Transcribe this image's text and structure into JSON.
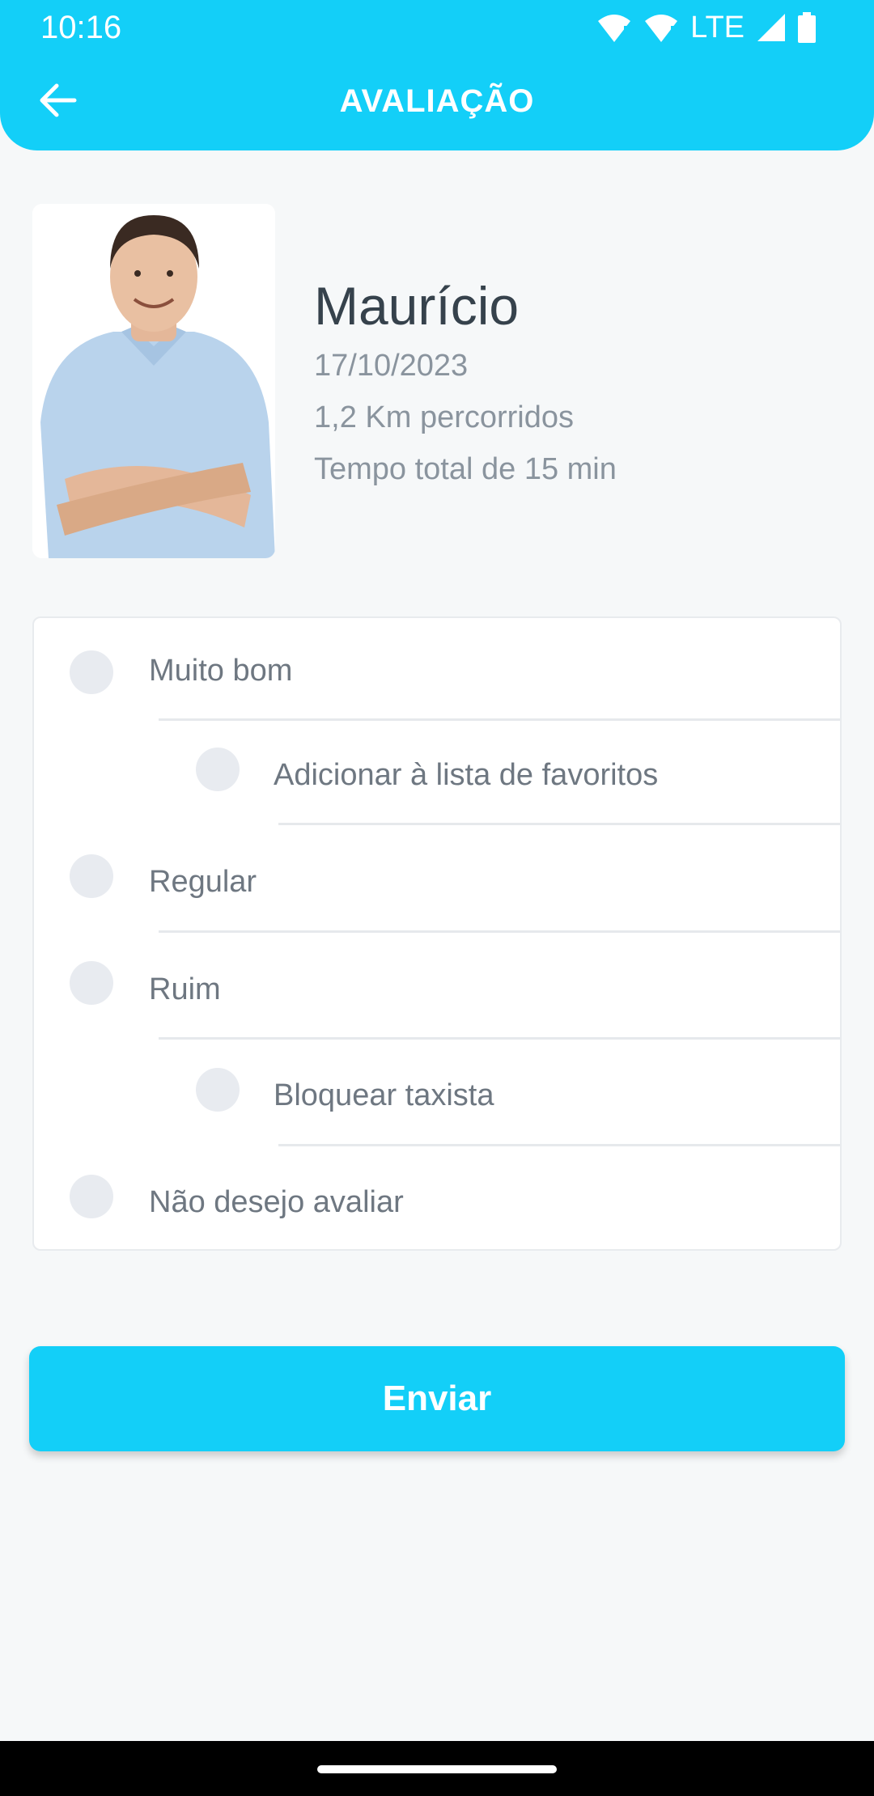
{
  "status_bar": {
    "time": "10:16",
    "network": "LTE",
    "icons": [
      "wifi-alert-icon",
      "wifi-alert-icon",
      "signal-icon",
      "battery-icon"
    ]
  },
  "header": {
    "title": "AVALIAÇÃO",
    "back_icon": "arrow-left-icon",
    "color": "#13cff8"
  },
  "driver": {
    "name": "Maurício",
    "date": "17/10/2023",
    "distance": "1,2 Km percorridos",
    "duration": "Tempo total de 15 min"
  },
  "options": [
    {
      "label": "Muito bom",
      "selected": false
    },
    {
      "label": "Adicionar à lista de favoritos",
      "selected": false
    },
    {
      "label": "Regular",
      "selected": false
    },
    {
      "label": "Ruim",
      "selected": false
    },
    {
      "label": "Bloquear taxista",
      "selected": false
    },
    {
      "label": "Não desejo avaliar",
      "selected": false
    }
  ],
  "submit": {
    "label": "Enviar"
  },
  "colors": {
    "accent": "#13cff8",
    "text_dark": "#36424c",
    "text_muted": "#8a949e"
  }
}
